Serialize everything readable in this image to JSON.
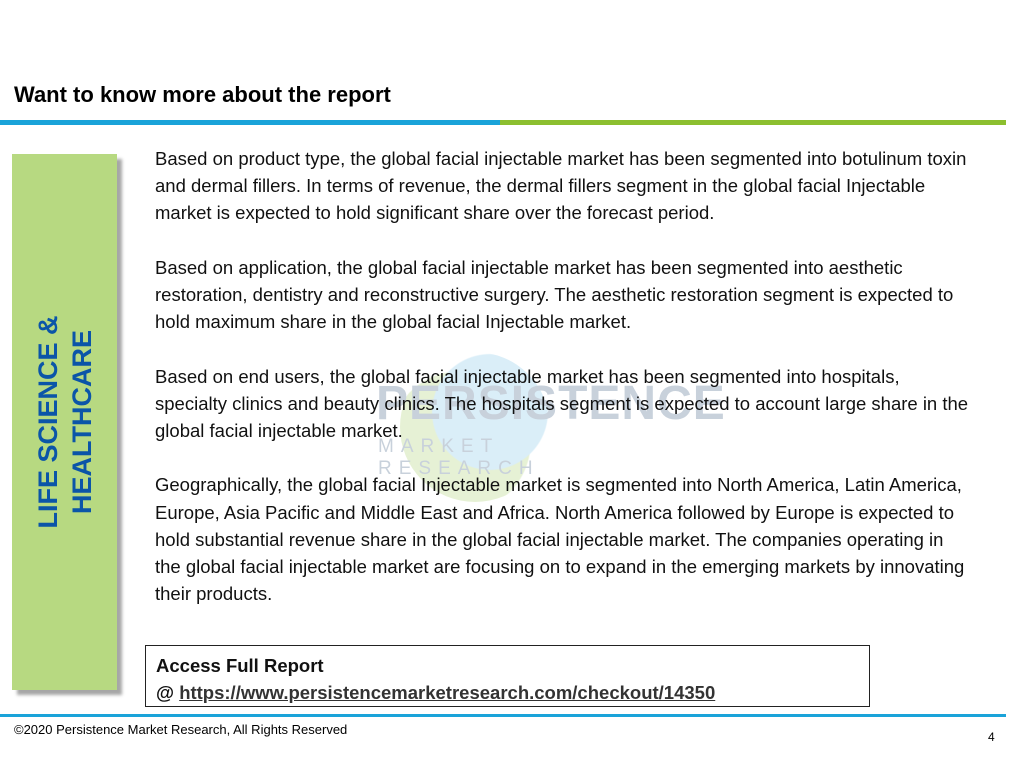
{
  "header": {
    "title": "Want to know more about the report"
  },
  "sidebar": {
    "line1": "LIFE SCIENCE &",
    "line2": "HEALTHCARE"
  },
  "watermark": {
    "word": "PERSISTENCE",
    "sub": "MARKET RESEARCH"
  },
  "content": {
    "paragraphs": [
      "Based on product type, the global facial injectable market has been segmented into botulinum toxin and dermal fillers. In terms of revenue, the dermal fillers segment in the global facial Injectable market is expected to hold significant share over the forecast period.",
      "Based on application, the global facial injectable market has been segmented into aesthetic restoration, dentistry and reconstructive surgery. The aesthetic restoration segment is expected to hold maximum share in the global facial Injectable market.",
      "Based on end users, the global facial injectable market has been segmented into hospitals, specialty clinics and beauty clinics. The hospitals segment is expected to account large share in the global facial injectable market.",
      "Geographically, the global facial Injectable market is segmented into North America, Latin America, Europe, Asia Pacific and Middle East and Africa. North America followed by Europe is expected to hold substantial revenue share in the global facial injectable market. The companies operating in the global facial injectable market are focusing on to expand in the emerging markets by innovating their products."
    ]
  },
  "access": {
    "title": "Access Full Report",
    "prefix": "@ ",
    "link_text": "https://www.persistencemarketresearch.com/checkout/14350"
  },
  "footer": {
    "copyright": "©2020 Persistence Market Research, All Rights Reserved",
    "page_number": "4"
  },
  "colors": {
    "accent_blue": "#1aa3d9",
    "accent_green": "#8cbf2f",
    "sidebar_bg": "#b7d981",
    "sidebar_text": "#0b55a8"
  }
}
